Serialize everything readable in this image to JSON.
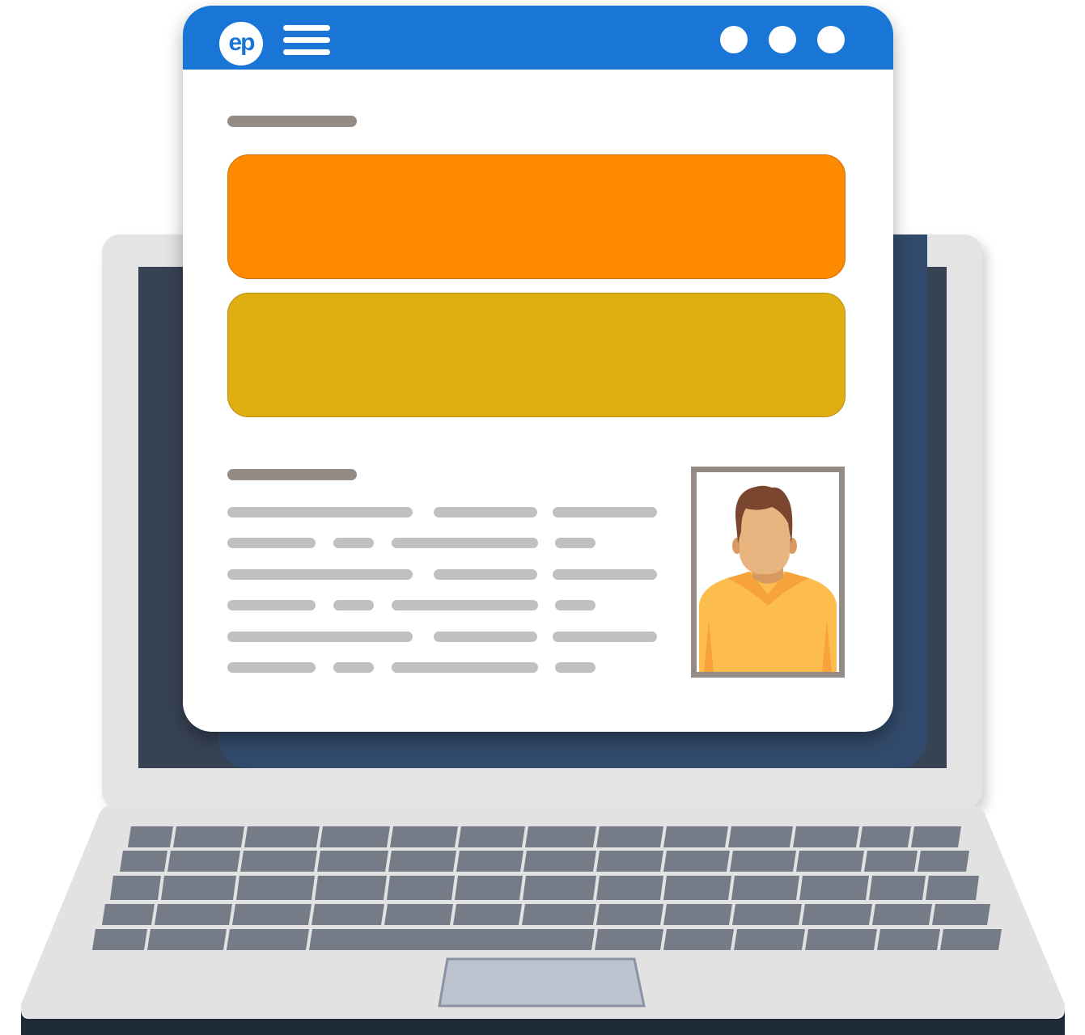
{
  "brand": {
    "logo_text": "ep"
  },
  "icons": {
    "logo": "ep-logo",
    "menu": "hamburger-menu-icon",
    "window_controls": [
      "circle-dot",
      "circle-dot",
      "circle-dot"
    ],
    "profile": "person-avatar"
  },
  "colors": {
    "header_blue": "#1976d6",
    "orange_banner": "#ff8a00",
    "gold_banner": "#dfae13",
    "screen_dark": "#374255",
    "keyboard_keys": "#767b88",
    "placeholder_dark": "#958b85",
    "placeholder_light": "#c0c0c0",
    "shirt": "#fdbd4e",
    "skin": "#e8b480",
    "hair": "#7a4630"
  }
}
